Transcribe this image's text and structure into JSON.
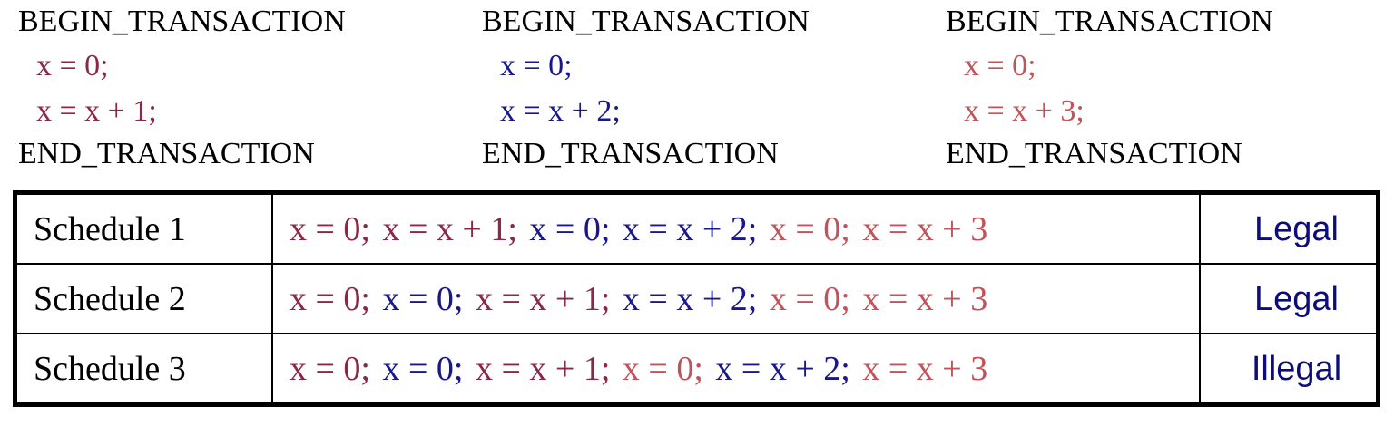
{
  "colors": {
    "t1": "#8b2846",
    "t2": "#18188a",
    "t3": "#c0545a",
    "text": "#000000",
    "verdict": "#0d0d7a"
  },
  "transactions": [
    {
      "begin": "BEGIN_TRANSACTION",
      "stmts": [
        "x = 0;",
        "x = x + 1;"
      ],
      "end": "END_TRANSACTION",
      "color": "t1"
    },
    {
      "begin": "BEGIN_TRANSACTION",
      "stmts": [
        "x = 0;",
        "x = x + 2;"
      ],
      "end": "END_TRANSACTION",
      "color": "t2"
    },
    {
      "begin": "BEGIN_TRANSACTION",
      "stmts": [
        "x = 0;",
        "x = x + 3;"
      ],
      "end": "END_TRANSACTION",
      "color": "t3"
    }
  ],
  "schedules": [
    {
      "name": "Schedule 1",
      "ops": [
        {
          "text": "x = 0;",
          "color": "t1"
        },
        {
          "text": "x = x + 1;",
          "color": "t1"
        },
        {
          "text": "x = 0;",
          "color": "t2"
        },
        {
          "text": "x = x + 2;",
          "color": "t2"
        },
        {
          "text": "x = 0;",
          "color": "t3"
        },
        {
          "text": "x = x + 3",
          "color": "t3"
        }
      ],
      "verdict": "Legal"
    },
    {
      "name": "Schedule 2",
      "ops": [
        {
          "text": "x = 0;",
          "color": "t1"
        },
        {
          "text": "x = 0;",
          "color": "t2"
        },
        {
          "text": "x = x + 1;",
          "color": "t1"
        },
        {
          "text": "x = x + 2;",
          "color": "t2"
        },
        {
          "text": "x = 0;",
          "color": "t3"
        },
        {
          "text": "x = x + 3",
          "color": "t3"
        }
      ],
      "verdict": "Legal"
    },
    {
      "name": "Schedule 3",
      "ops": [
        {
          "text": "x = 0;",
          "color": "t1"
        },
        {
          "text": "x = 0;",
          "color": "t2"
        },
        {
          "text": "x = x + 1;",
          "color": "t1"
        },
        {
          "text": "x = 0;",
          "color": "t3"
        },
        {
          "text": "x = x + 2;",
          "color": "t2"
        },
        {
          "text": "x = x + 3",
          "color": "t3"
        }
      ],
      "verdict": "Illegal"
    }
  ]
}
